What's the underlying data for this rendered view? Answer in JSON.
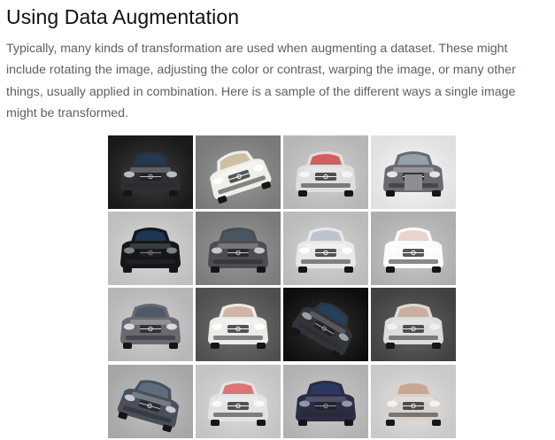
{
  "article": {
    "heading": "Using Data Augmentation",
    "intro": "Typically, many kinds of transformation are used when augmenting a dataset. These might include rotating the image, adjusting the color or contrast, warping the image, or many other things, usually applied in combination. Here is a sample of the different ways a single image might be transformed."
  },
  "figure": {
    "subject_icon": "car-front-icon",
    "tiles": [
      {
        "bg": "#1c1c1c",
        "body": "#2e2e33",
        "glass": "#233a55",
        "light": "#b8bcc4",
        "rot": 0,
        "mirror": false,
        "bright": 1.0,
        "patch": false
      },
      {
        "bg": "#8a8a8a",
        "body": "#efefea",
        "glass": "#c9b89c",
        "light": "#ffffff",
        "rot": -18,
        "mirror": false,
        "bright": 1.0,
        "patch": false
      },
      {
        "bg": "#cfcfcf",
        "body": "#dedede",
        "glass": "#d05050",
        "light": "#f5f5f5",
        "rot": 0,
        "mirror": false,
        "bright": 1.0,
        "patch": false
      },
      {
        "bg": "#ffffff",
        "body": "#6a6a70",
        "glass": "#9aa6b4",
        "light": "#e6e6e6",
        "rot": 0,
        "mirror": false,
        "bright": 1.0,
        "patch": true
      },
      {
        "bg": "#d9d9d9",
        "body": "#16161a",
        "glass": "#1b3a5a",
        "light": "#7c8088",
        "rot": 0,
        "mirror": false,
        "bright": 1.0,
        "patch": false
      },
      {
        "bg": "#8c8c8c",
        "body": "#4c4c52",
        "glass": "#4a5866",
        "light": "#c8c8c8",
        "rot": 0,
        "mirror": true,
        "bright": 1.0,
        "patch": false
      },
      {
        "bg": "#d4d4d4",
        "body": "#e8e8ea",
        "glass": "#b9c0c8",
        "light": "#ffffff",
        "rot": 0,
        "mirror": false,
        "bright": 1.0,
        "patch": false
      },
      {
        "bg": "#c6c6c6",
        "body": "#fbfbfb",
        "glass": "#e4d0c8",
        "light": "#ffffff",
        "rot": 0,
        "mirror": false,
        "bright": 1.0,
        "patch": false
      },
      {
        "bg": "#cfcfcf",
        "body": "#6a6870",
        "glass": "#4e5866",
        "light": "#dadada",
        "rot": 0,
        "mirror": false,
        "bright": 1.0,
        "patch": false
      },
      {
        "bg": "#5a5a5a",
        "body": "#ecebe8",
        "glass": "#cfae9c",
        "light": "#ffffff",
        "rot": 0,
        "mirror": false,
        "bright": 1.0,
        "patch": false
      },
      {
        "bg": "#0f0f0f",
        "body": "#33333a",
        "glass": "#204060",
        "light": "#9a9ea6",
        "rot": 30,
        "mirror": false,
        "bright": 1.0,
        "patch": false
      },
      {
        "bg": "#4a4a4a",
        "body": "#dcdcda",
        "glass": "#c8a898",
        "light": "#f0f0f0",
        "rot": 0,
        "mirror": false,
        "bright": 1.0,
        "patch": false
      },
      {
        "bg": "#bdbdbd",
        "body": "#4a4f5c",
        "glass": "#607080",
        "light": "#c8cad0",
        "rot": 16,
        "mirror": false,
        "bright": 1.0,
        "patch": false
      },
      {
        "bg": "#dedede",
        "body": "#e3e3e3",
        "glass": "#d86868",
        "light": "#f7f7f7",
        "rot": 0,
        "mirror": false,
        "bright": 1.0,
        "patch": false
      },
      {
        "bg": "#c9c9c9",
        "body": "#2c2c44",
        "glass": "#2a3a66",
        "light": "#9296a8",
        "rot": 0,
        "mirror": false,
        "bright": 1.0,
        "patch": false
      },
      {
        "bg": "#e4e4e4",
        "body": "#d8d2cc",
        "glass": "#c8a090",
        "light": "#f4f2ee",
        "rot": 0,
        "mirror": false,
        "bright": 1.0,
        "patch": false
      }
    ]
  }
}
